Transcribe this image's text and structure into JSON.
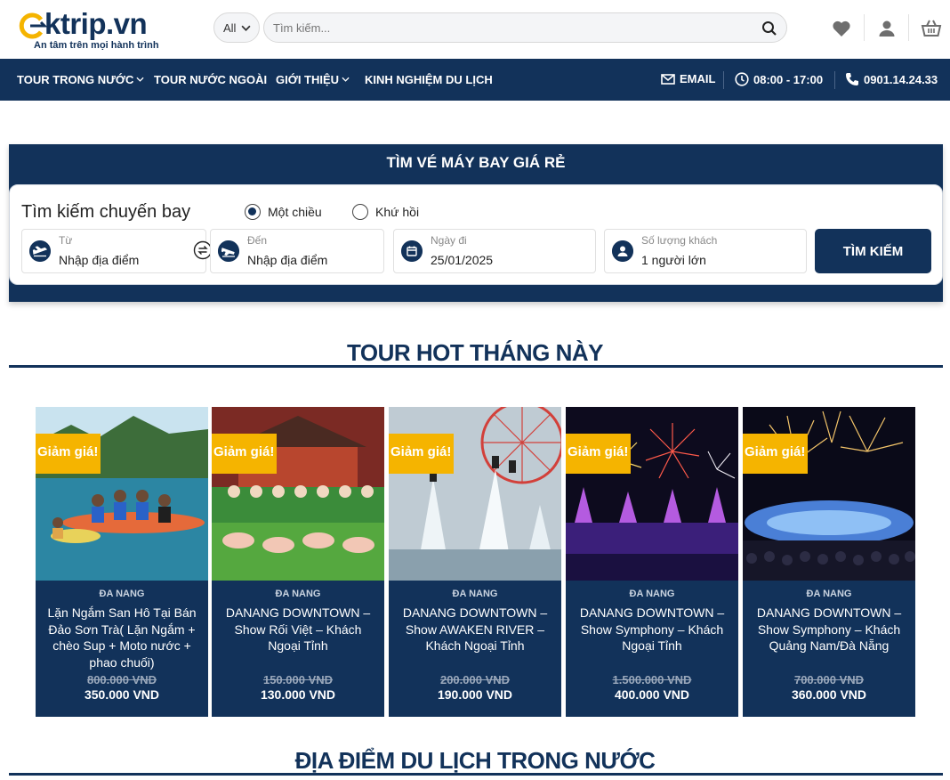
{
  "header": {
    "logo_text": "ktrip.vn",
    "tagline": "An tâm trên mọi hành trình",
    "category_select": "All",
    "search_placeholder": "Tìm kiếm..."
  },
  "nav": {
    "items": [
      "TOUR TRONG NƯỚC",
      "TOUR NƯỚC NGOÀI",
      "GIỚI THIỆU",
      "KINH NGHIỆM DU LỊCH"
    ],
    "email": "EMAIL",
    "hours": "08:00 - 17:00",
    "phone": "0901.14.24.33"
  },
  "flight": {
    "title": "TÌM VÉ MÁY BAY GIÁ RẺ",
    "panel_title": "Tìm kiếm chuyến bay",
    "trip_one_way": "Một chiều",
    "trip_round": "Khứ hồi",
    "from_label": "Từ",
    "from_value": "Nhập địa điểm",
    "to_label": "Đến",
    "to_value": "Nhập địa điểm",
    "date_label": "Ngày đi",
    "date_value": "25/01/2025",
    "pax_label": "Số lượng khách",
    "pax_value": "1 người lớn",
    "search_button": "TÌM KIẾM"
  },
  "hot_tours": {
    "title": "TOUR HOT THÁNG NÀY",
    "badge": "Giảm giá!",
    "cards": [
      {
        "category": "ĐA NANG",
        "name": "Lặn Ngắm San Hô Tại Bán Đảo Sơn Trà( Lặn Ngắm + chèo Sup + Moto nước + phao chuối)",
        "old_price": "800.000 VND",
        "price": "350.000 VND"
      },
      {
        "category": "ĐA NANG",
        "name": "DANANG DOWNTOWN – Show Rối Việt – Khách Ngoại Tỉnh",
        "old_price": "150.000 VND",
        "price": "130.000 VND"
      },
      {
        "category": "ĐA NANG",
        "name": "DANANG DOWNTOWN – Show AWAKEN RIVER – Khách Ngoại Tỉnh",
        "old_price": "200.000 VND",
        "price": "190.000 VND"
      },
      {
        "category": "ĐA NANG",
        "name": "DANANG DOWNTOWN – Show Symphony – Khách Ngoại Tỉnh",
        "old_price": "1.500.000 VND",
        "price": "400.000 VND"
      },
      {
        "category": "ĐA NANG",
        "name": "DANANG DOWNTOWN – Show Symphony – Khách Quảng Nam/Đà Nẵng",
        "old_price": "700.000 VND",
        "price": "360.000 VND"
      }
    ]
  },
  "domestic": {
    "title": "ĐỊA ĐIỂM DU LỊCH TRONG NƯỚC"
  },
  "colors": {
    "navy": "#12325a",
    "badge_yellow": "#f5b400"
  }
}
